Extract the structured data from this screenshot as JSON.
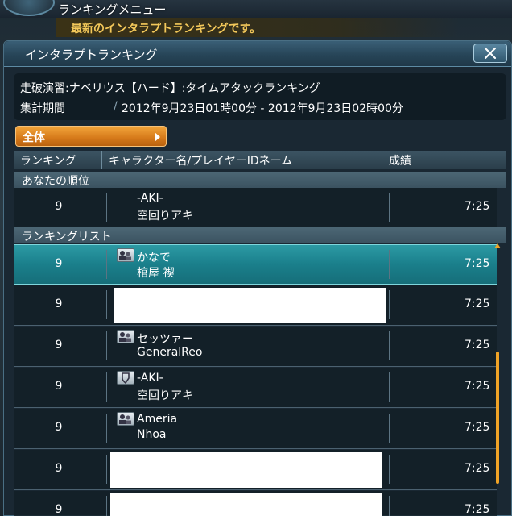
{
  "top_menu": {
    "title": "ランキングメニュー",
    "notice": "最新のインタラプトランキングです。"
  },
  "window": {
    "title": "インタラプトランキング",
    "close_icon": "close-x-icon"
  },
  "info": {
    "event": "走破演習:ナベリウス【ハード】:タイムアタックランキング",
    "period_label": "集計期間",
    "period_value": "2012年9月23日01時00分 - 2012年9月23日02時00分"
  },
  "filter": {
    "label": "全体",
    "icon": "arrow-right-icon"
  },
  "columns": {
    "rank": "ランキング",
    "name": "キャラクター名/プレイヤーIDネーム",
    "score": "成績"
  },
  "your_rank": {
    "title": "あなたの順位",
    "row": {
      "rank": "9",
      "name1": "-AKI-",
      "name2": "空回りアキ",
      "time": "7:25"
    }
  },
  "ranking_list": {
    "title": "ランキングリスト",
    "rows": [
      {
        "rank": "9",
        "name1": "かなで",
        "name2": "棺屋 禊",
        "time": "7:25",
        "icon": "party-icon"
      },
      {
        "rank": "9",
        "name1": "",
        "name2": "",
        "time": "7:25",
        "icon": ""
      },
      {
        "rank": "9",
        "name1": "セッツァー",
        "name2": "GeneralReo",
        "time": "7:25",
        "icon": "party-icon"
      },
      {
        "rank": "9",
        "name1": "-AKI-",
        "name2": "空回りアキ",
        "time": "7:25",
        "icon": "shield-icon"
      },
      {
        "rank": "9",
        "name1": "Ameria",
        "name2": "Nhoa",
        "time": "7:25",
        "icon": "party-icon"
      },
      {
        "rank": "9",
        "name1": "",
        "name2": "",
        "time": "7:25",
        "icon": ""
      },
      {
        "rank": "9",
        "name1": "",
        "name2": "",
        "time": "7:25",
        "icon": ""
      }
    ]
  },
  "colors": {
    "accent_orange": "#f0a326",
    "highlight_teal": "#1a7f8b",
    "notice_gold": "#f3c85a"
  }
}
